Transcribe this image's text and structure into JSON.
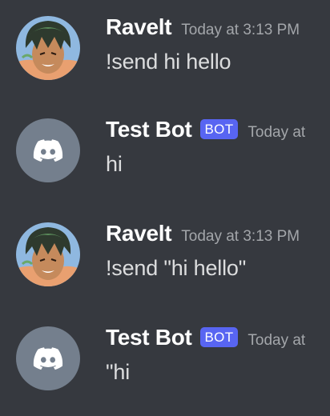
{
  "messages": [
    {
      "author": "Ravelt",
      "timestamp": "Today at 3:13 PM",
      "content": "!send hi hello",
      "is_bot": false,
      "avatar": "anime-character-avatar"
    },
    {
      "author": "Test Bot",
      "bot_tag": "BOT",
      "timestamp": "Today at",
      "content": "hi",
      "is_bot": true,
      "avatar": "discord-logo-icon"
    },
    {
      "author": "Ravelt",
      "timestamp": "Today at 3:13 PM",
      "content": "!send \"hi hello\"",
      "is_bot": false,
      "avatar": "anime-character-avatar"
    },
    {
      "author": "Test Bot",
      "bot_tag": "BOT",
      "timestamp": "Today at",
      "content": "\"hi",
      "is_bot": true,
      "avatar": "discord-logo-icon"
    }
  ],
  "colors": {
    "background": "#36393f",
    "username": "#ffffff",
    "timestamp": "#a3a6aa",
    "content": "#dcddde",
    "bot_tag": "#5865f2",
    "bot_avatar_bg": "#747f8d"
  }
}
